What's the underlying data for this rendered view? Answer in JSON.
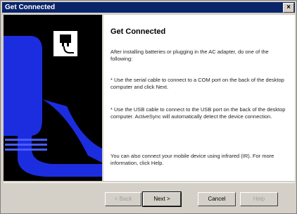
{
  "window": {
    "title": "Get Connected"
  },
  "content": {
    "heading": "Get Connected",
    "intro": "After installing batteries or plugging in the AC adapter, do one of the following:",
    "option_serial": "* Use the serial cable to connect to a COM port on the back of the desktop computer and click Next.",
    "option_usb": "* Use the USB cable to connect to the USB port on the back of the desktop computer. ActiveSync will automatically detect the device connection.",
    "infrared": "You can also connect your mobile device using infrared (IR). For more information, click Help."
  },
  "buttons": {
    "back": "< Back",
    "next": "Next >",
    "cancel": "Cancel",
    "help": "Help"
  },
  "colors": {
    "art_blue": "#1c2de0",
    "titlebar": "#0a246a"
  }
}
